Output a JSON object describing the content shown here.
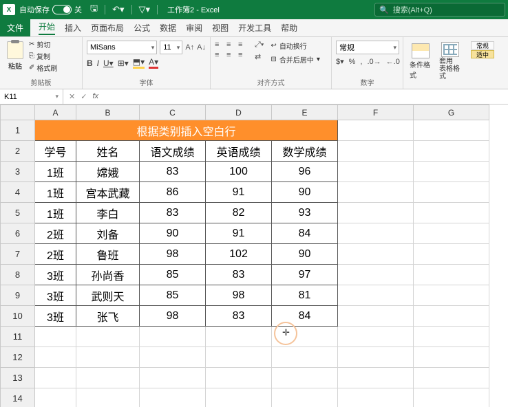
{
  "titlebar": {
    "autosave_label": "自动保存",
    "autosave_state": "关",
    "doc_title": "工作簿2 - Excel",
    "search_placeholder": "搜索(Alt+Q)"
  },
  "menu": {
    "file": "文件",
    "home": "开始",
    "insert": "插入",
    "layout": "页面布局",
    "formulas": "公式",
    "data": "数据",
    "review": "审阅",
    "view": "视图",
    "dev": "开发工具",
    "help": "帮助"
  },
  "ribbon": {
    "clipboard": {
      "paste": "粘贴",
      "cut": "剪切",
      "copy": "复制",
      "painter": "格式刷",
      "label": "剪贴板"
    },
    "font": {
      "name": "MiSans",
      "size": "11",
      "label": "字体"
    },
    "align": {
      "wrap": "自动换行",
      "merge": "合并后居中",
      "label": "对齐方式"
    },
    "number": {
      "format": "常规",
      "label": "数字"
    },
    "styles": {
      "cond": "条件格式",
      "table": "套用\n表格格式",
      "normal": "常规",
      "medium": "适中"
    }
  },
  "namebox": {
    "ref": "K11"
  },
  "columns": [
    "A",
    "B",
    "C",
    "D",
    "E",
    "F",
    "G"
  ],
  "rows": [
    "1",
    "2",
    "3",
    "4",
    "5",
    "6",
    "7",
    "8",
    "9",
    "10",
    "11",
    "12",
    "13",
    "14"
  ],
  "sheet": {
    "title": "根据类别插入空白行",
    "headers": [
      "学号",
      "姓名",
      "语文成绩",
      "英语成绩",
      "数学成绩"
    ],
    "data": [
      [
        "1班",
        "嫦娥",
        "83",
        "100",
        "96"
      ],
      [
        "1班",
        "宫本武藏",
        "86",
        "91",
        "90"
      ],
      [
        "1班",
        "李白",
        "83",
        "82",
        "93"
      ],
      [
        "2班",
        "刘备",
        "90",
        "91",
        "84"
      ],
      [
        "2班",
        "鲁班",
        "98",
        "102",
        "90"
      ],
      [
        "3班",
        "孙尚香",
        "85",
        "83",
        "97"
      ],
      [
        "3班",
        "武则天",
        "85",
        "98",
        "81"
      ],
      [
        "3班",
        "张飞",
        "98",
        "83",
        "84"
      ]
    ]
  }
}
